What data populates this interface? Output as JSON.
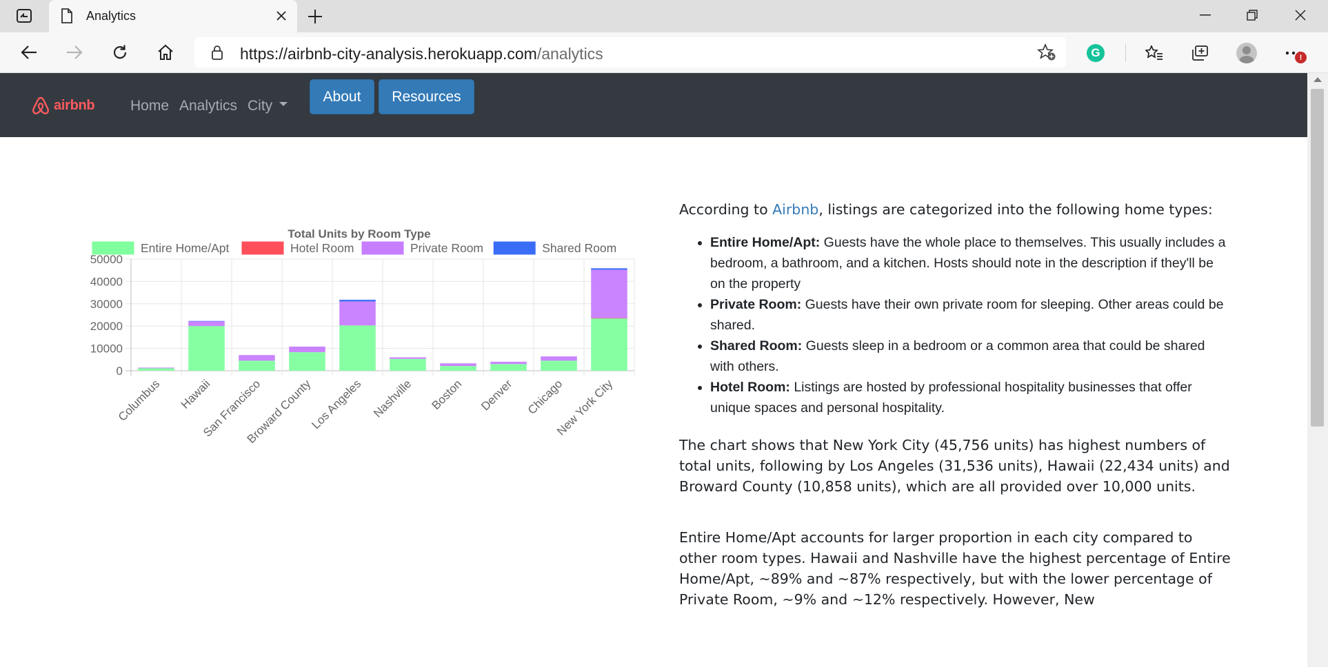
{
  "browser": {
    "tab_title": "Analytics",
    "url_host": "https://airbnb-city-analysis.herokuapp.com",
    "url_path": "/analytics",
    "notification_badge": "!"
  },
  "navbar": {
    "brand": "airbnb",
    "links": [
      "Home",
      "Analytics",
      "City"
    ],
    "about_label": "About",
    "resources_label": "Resources",
    "brand_color": "#ff5a5f",
    "button_color": "#337ab7"
  },
  "chart_data": {
    "type": "bar",
    "stacked": true,
    "title": "Total Units by Room Type",
    "categories": [
      "Columbus",
      "Hawaii",
      "San Francisco",
      "Broward County",
      "Los Angeles",
      "Nashville",
      "Boston",
      "Denver",
      "Chicago",
      "New York City"
    ],
    "series": [
      {
        "name": "Entire Home/Apt",
        "color": "#80ff9e",
        "values": [
          1100,
          20000,
          4500,
          8300,
          20300,
          5300,
          2100,
          3000,
          4500,
          23500
        ]
      },
      {
        "name": "Hotel Room",
        "color": "#ff4f5b",
        "values": [
          0,
          0,
          0,
          0,
          0,
          0,
          0,
          0,
          0,
          100
        ]
      },
      {
        "name": "Private Room",
        "color": "#c77dff",
        "values": [
          300,
          2200,
          2500,
          2500,
          10700,
          700,
          1200,
          1000,
          1900,
          21600
        ]
      },
      {
        "name": "Shared Room",
        "color": "#3a6df5",
        "values": [
          0,
          100,
          0,
          0,
          800,
          0,
          0,
          0,
          0,
          700
        ]
      }
    ],
    "ylim": [
      0,
      50000
    ],
    "yticks": [
      "0",
      "10000",
      "20000",
      "30000",
      "40000",
      "50000"
    ],
    "grid": true,
    "legend": "top"
  },
  "content": {
    "intro_before": "According to ",
    "intro_link": "Airbnb",
    "intro_after": ", listings are categorized into the following home types:",
    "types": [
      {
        "name": "Entire Home/Apt:",
        "desc": " Guests have the whole place to themselves. This usually includes a bedroom, a bathroom, and a kitchen. Hosts should note in the description if they'll be on the property"
      },
      {
        "name": "Private Room:",
        "desc": " Guests have their own private room for sleeping. Other areas could be shared."
      },
      {
        "name": "Shared Room:",
        "desc": " Guests sleep in a bedroom or a common area that could be shared with others."
      },
      {
        "name": "Hotel Room:",
        "desc": " Listings are hosted by professional hospitality businesses that offer unique spaces and personal hospitality."
      }
    ],
    "paragraph1": "The chart shows that New York City (45,756 units) has highest numbers of total units, following by Los Angeles (31,536 units), Hawaii (22,434 units) and Broward County (10,858 units), which are all provided over 10,000 units.",
    "paragraph2": "Entire Home/Apt accounts for larger proportion in each city compared to other room types. Hawaii and Nashville have the highest percentage of Entire Home/Apt, ~89% and ~87% respectively, but with the lower percentage of Private Room, ~9% and ~12% respectively. However, New"
  }
}
